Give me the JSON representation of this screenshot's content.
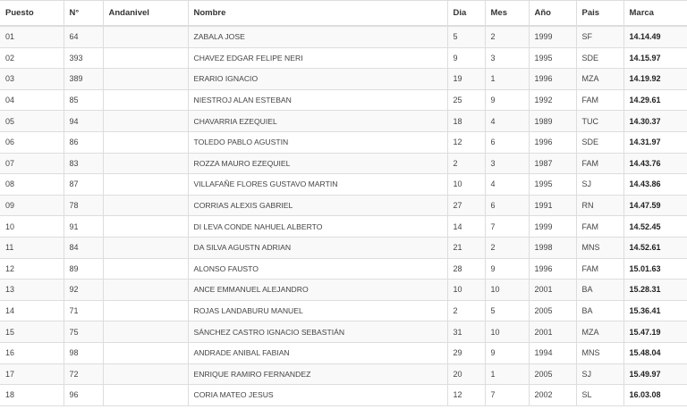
{
  "headers": {
    "puesto": "Puesto",
    "numero": "N°",
    "andanivel": "Andanivel",
    "nombre": "Nombre",
    "dia": "Dia",
    "mes": "Mes",
    "anio": "Año",
    "pais": "Pais",
    "marca": "Marca"
  },
  "rows": [
    {
      "puesto": "01",
      "numero": "64",
      "andanivel": "",
      "nombre": "ZABALA JOSE",
      "dia": "5",
      "mes": "2",
      "anio": "1999",
      "pais": "SF",
      "marca": "14.14.49"
    },
    {
      "puesto": "02",
      "numero": "393",
      "andanivel": "",
      "nombre": "CHAVEZ EDGAR FELIPE NERI",
      "dia": "9",
      "mes": "3",
      "anio": "1995",
      "pais": "SDE",
      "marca": "14.15.97"
    },
    {
      "puesto": "03",
      "numero": "389",
      "andanivel": "",
      "nombre": "ERARIO IGNACIO",
      "dia": "19",
      "mes": "1",
      "anio": "1996",
      "pais": "MZA",
      "marca": "14.19.92"
    },
    {
      "puesto": "04",
      "numero": "85",
      "andanivel": "",
      "nombre": "NIESTROJ ALAN ESTEBAN",
      "dia": "25",
      "mes": "9",
      "anio": "1992",
      "pais": "FAM",
      "marca": "14.29.61"
    },
    {
      "puesto": "05",
      "numero": "94",
      "andanivel": "",
      "nombre": "CHAVARRIA EZEQUIEL",
      "dia": "18",
      "mes": "4",
      "anio": "1989",
      "pais": "TUC",
      "marca": "14.30.37"
    },
    {
      "puesto": "06",
      "numero": "86",
      "andanivel": "",
      "nombre": "TOLEDO PABLO AGUSTIN",
      "dia": "12",
      "mes": "6",
      "anio": "1996",
      "pais": "SDE",
      "marca": "14.31.97"
    },
    {
      "puesto": "07",
      "numero": "83",
      "andanivel": "",
      "nombre": "ROZZA MAURO EZEQUIEL",
      "dia": "2",
      "mes": "3",
      "anio": "1987",
      "pais": "FAM",
      "marca": "14.43.76"
    },
    {
      "puesto": "08",
      "numero": "87",
      "andanivel": "",
      "nombre": "VILLAFAÑE FLORES GUSTAVO MARTIN",
      "dia": "10",
      "mes": "4",
      "anio": "1995",
      "pais": "SJ",
      "marca": "14.43.86"
    },
    {
      "puesto": "09",
      "numero": "78",
      "andanivel": "",
      "nombre": "CORRIAS ALEXIS GABRIEL",
      "dia": "27",
      "mes": "6",
      "anio": "1991",
      "pais": "RN",
      "marca": "14.47.59"
    },
    {
      "puesto": "10",
      "numero": "91",
      "andanivel": "",
      "nombre": "DI LEVA CONDE NAHUEL ALBERTO",
      "dia": "14",
      "mes": "7",
      "anio": "1999",
      "pais": "FAM",
      "marca": "14.52.45"
    },
    {
      "puesto": "11",
      "numero": "84",
      "andanivel": "",
      "nombre": "DA SILVA AGUSTN ADRIAN",
      "dia": "21",
      "mes": "2",
      "anio": "1998",
      "pais": "MNS",
      "marca": "14.52.61"
    },
    {
      "puesto": "12",
      "numero": "89",
      "andanivel": "",
      "nombre": "ALONSO FAUSTO",
      "dia": "28",
      "mes": "9",
      "anio": "1996",
      "pais": "FAM",
      "marca": "15.01.63"
    },
    {
      "puesto": "13",
      "numero": "92",
      "andanivel": "",
      "nombre": "ANCE EMMANUEL ALEJANDRO",
      "dia": "10",
      "mes": "10",
      "anio": "2001",
      "pais": "BA",
      "marca": "15.28.31"
    },
    {
      "puesto": "14",
      "numero": "71",
      "andanivel": "",
      "nombre": "ROJAS LANDABURU MANUEL",
      "dia": "2",
      "mes": "5",
      "anio": "2005",
      "pais": "BA",
      "marca": "15.36.41"
    },
    {
      "puesto": "15",
      "numero": "75",
      "andanivel": "",
      "nombre": "SÁNCHEZ CASTRO IGNACIO SEBASTIÁN",
      "dia": "31",
      "mes": "10",
      "anio": "2001",
      "pais": "MZA",
      "marca": "15.47.19"
    },
    {
      "puesto": "16",
      "numero": "98",
      "andanivel": "",
      "nombre": "ANDRADE ANIBAL FABIAN",
      "dia": "29",
      "mes": "9",
      "anio": "1994",
      "pais": "MNS",
      "marca": "15.48.04"
    },
    {
      "puesto": "17",
      "numero": "72",
      "andanivel": "",
      "nombre": "ENRIQUE RAMIRO FERNANDEZ",
      "dia": "20",
      "mes": "1",
      "anio": "2005",
      "pais": "SJ",
      "marca": "15.49.97"
    },
    {
      "puesto": "18",
      "numero": "96",
      "andanivel": "",
      "nombre": "CORIA MATEO JESUS",
      "dia": "12",
      "mes": "7",
      "anio": "2002",
      "pais": "SL",
      "marca": "16.03.08"
    }
  ]
}
